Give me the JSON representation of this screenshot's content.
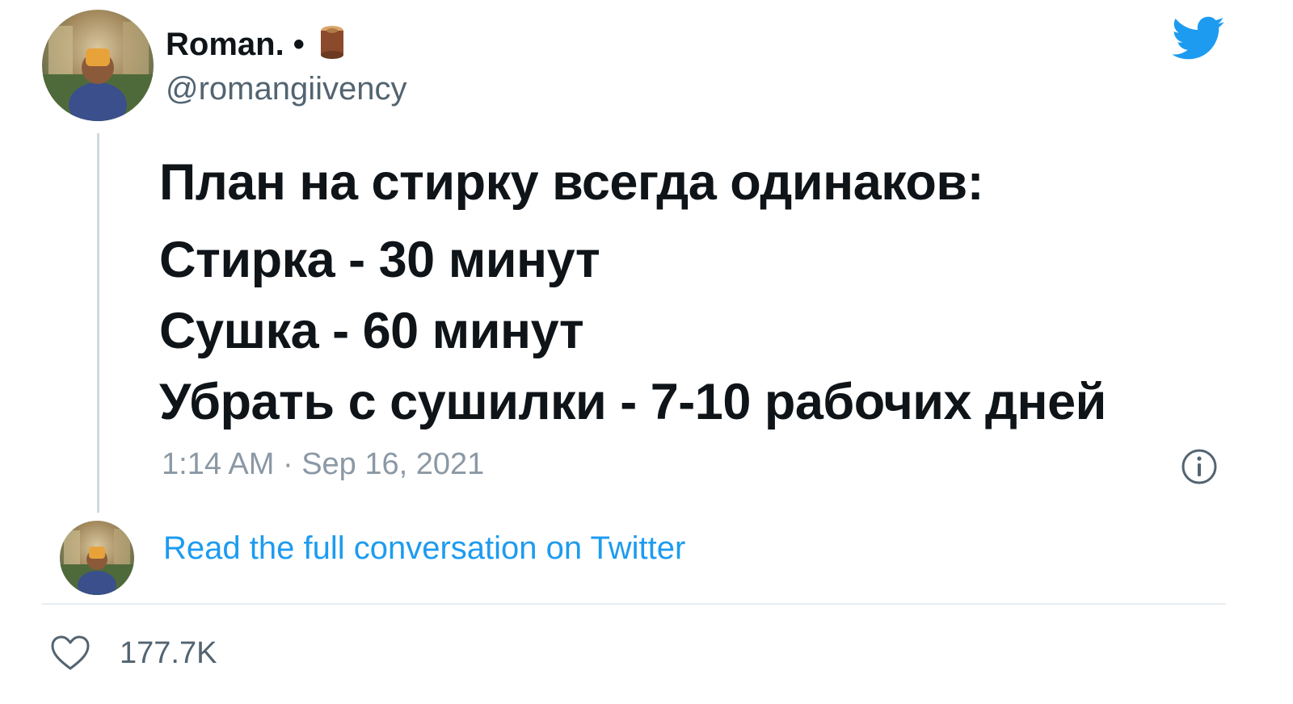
{
  "author": {
    "display_name": "Roman.",
    "handle": "@romangiivency",
    "avatar_icon": "avatar-photo"
  },
  "tweet": {
    "lines": [
      "План на стирку всегда одинаков:",
      "Стирка - 30 минут",
      "Сушка - 60 минут",
      "Убрать с сушилки - 7-10 рабочих дней"
    ],
    "timestamp": "1:14 AM · Sep 16, 2021"
  },
  "conversation_link": "Read the full conversation on Twitter",
  "likes": "177.7K",
  "colors": {
    "link": "#1d9bf0",
    "secondary_text": "#536471",
    "twitter_blue": "#1d9bf0"
  }
}
